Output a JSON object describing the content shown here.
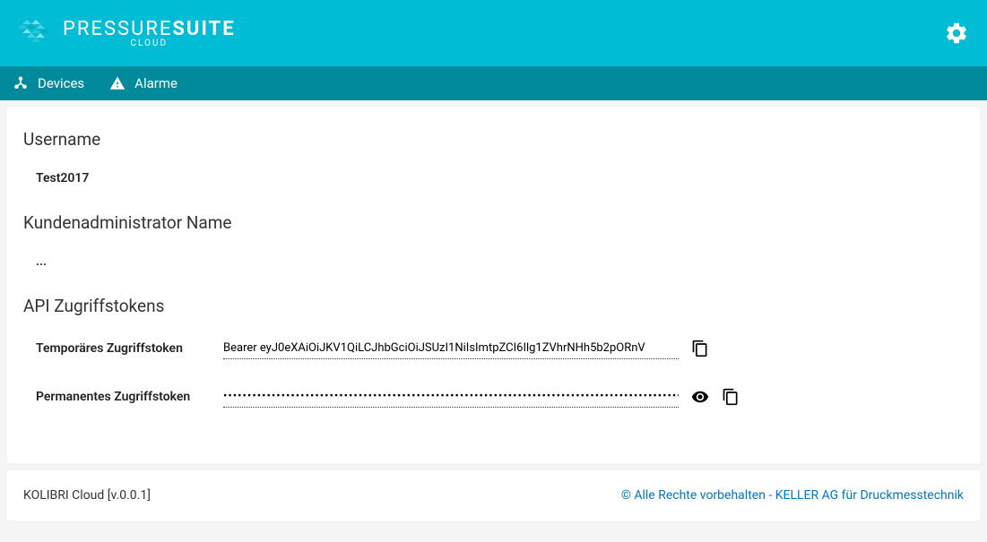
{
  "header": {
    "logo_main": "PRESSURE",
    "logo_main_bold": "SUITE",
    "logo_sub": "CLOUD"
  },
  "nav": {
    "devices": "Devices",
    "alarme": "Alarme"
  },
  "content": {
    "username_label": "Username",
    "username_value": "Test2017",
    "admin_label": "Kundenadministrator Name",
    "admin_value": "...",
    "tokens_label": "API Zugriffstokens",
    "temp_token_label": "Temporäres Zugriffstoken",
    "temp_token_value": "Bearer eyJ0eXAiOiJKV1QiLCJhbGciOiJSUzI1NiIsImtpZCI6Ilg1ZVhrNHh5b2pORnV",
    "perm_token_label": "Permanentes Zugriffstoken",
    "perm_token_value": "••••••••••••••••••••••••••••••••••••••••••••••••••••••••••••••••••••••••••••••••••••••••••••••••••••••••••••••••"
  },
  "footer": {
    "left": "KOLIBRI Cloud [v.0.0.1]",
    "right": "© Alle Rechte vorbehalten - KELLER AG für Druckmesstechnik"
  }
}
